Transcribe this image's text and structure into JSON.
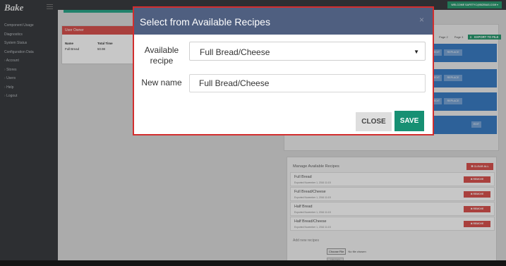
{
  "app": {
    "logo": "Bake"
  },
  "sidebar": {
    "items": [
      "Component Usage",
      "Diagnostics",
      "System Status",
      "Configuration Data",
      "Account",
      "Stores",
      "Users",
      "Help",
      "Logout"
    ]
  },
  "header": {
    "welcome": "WELCOME SAFETYC@BIZBIAS.COM ▾"
  },
  "user_panel": {
    "title": "User Owner",
    "columns": [
      "Name",
      "Total Time"
    ],
    "rows": [
      [
        "Full Bread",
        "50.98"
      ]
    ]
  },
  "right_panel": {
    "pager": [
      "Page 2",
      "Page 3"
    ],
    "export_label": "EXPORT TO FILE",
    "edit_label": "EDIT",
    "replace_label": "REPLACE",
    "partial_label": "ne"
  },
  "manage": {
    "title": "Manage Available Recipes",
    "clear_all": "✖ CLEAR ALL",
    "remove_label": "✖ REMOVE",
    "recipes": [
      {
        "name": "Full Bread",
        "exported": "Exported November 1, 2016 11:15"
      },
      {
        "name": "Full Bread/Cheese",
        "exported": "Exported November 1, 2016 11:15"
      },
      {
        "name": "Half Bread",
        "exported": "Exported November 1, 2016 11:15"
      },
      {
        "name": "Half Bread/Cheese",
        "exported": "Exported November 1, 2016 11:15"
      }
    ],
    "add_title": "Add new recipes",
    "choose_file": "Choose File",
    "no_file": "No file chosen",
    "upload": "UPLOAD"
  },
  "modal": {
    "title": "Select from Available Recipes",
    "close_x": "×",
    "recipe_label": "Available recipe",
    "recipe_value": "Full Bread/Cheese",
    "name_label": "New name",
    "name_value": "Full Bread/Cheese",
    "close_button": "CLOSE",
    "save_button": "SAVE"
  },
  "colors": {
    "modal_header": "#4f5f80",
    "save": "#179073",
    "danger": "#d9534f",
    "accent": "#2b9a70"
  }
}
